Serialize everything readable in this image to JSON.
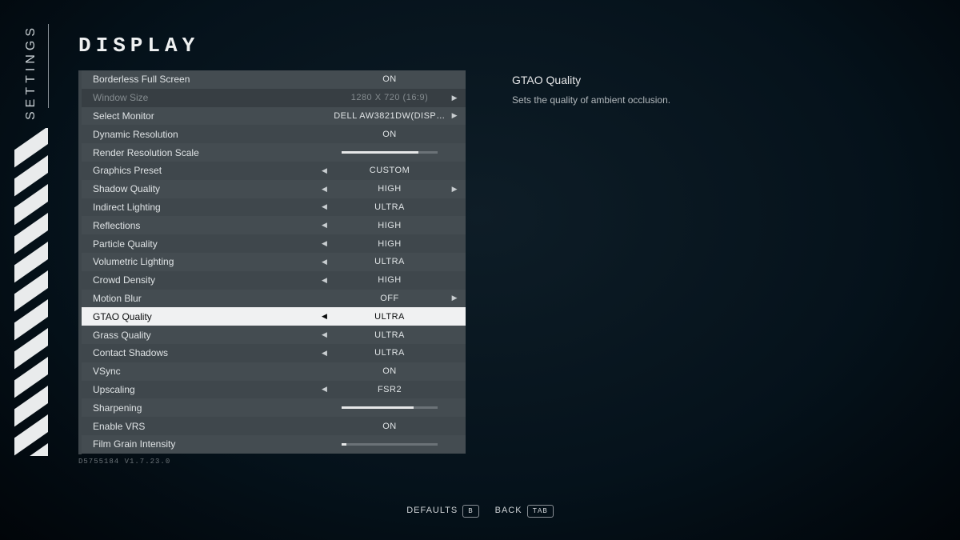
{
  "sidebarLabel": "SETTINGS",
  "pageTitle": "DISPLAY",
  "buildId": "D5755184 V1.7.23.0",
  "description": {
    "title": "GTAO Quality",
    "body": "Sets the quality of ambient occlusion."
  },
  "footer": {
    "defaults": {
      "label": "DEFAULTS",
      "key": "B"
    },
    "back": {
      "label": "BACK",
      "key": "TAB"
    }
  },
  "rows": [
    {
      "label": "Borderless Full Screen",
      "value": "ON",
      "type": "toggle"
    },
    {
      "label": "Window Size",
      "value": "1280 X 720 (16:9)",
      "type": "arrow",
      "showLeft": false,
      "showRight": true,
      "disabled": true
    },
    {
      "label": "Select Monitor",
      "value": "DELL AW3821DW(DISP…",
      "type": "arrow",
      "showLeft": false,
      "showRight": true
    },
    {
      "label": "Dynamic Resolution",
      "value": "ON",
      "type": "toggle"
    },
    {
      "label": "Render Resolution Scale",
      "value": "",
      "type": "slider",
      "pct": 80
    },
    {
      "label": "Graphics Preset",
      "value": "CUSTOM",
      "type": "arrow",
      "showLeft": true,
      "showRight": false
    },
    {
      "label": "Shadow Quality",
      "value": "HIGH",
      "type": "arrow",
      "showLeft": true,
      "showRight": true
    },
    {
      "label": "Indirect Lighting",
      "value": "ULTRA",
      "type": "arrow",
      "showLeft": true,
      "showRight": false
    },
    {
      "label": "Reflections",
      "value": "HIGH",
      "type": "arrow",
      "showLeft": true,
      "showRight": false
    },
    {
      "label": "Particle Quality",
      "value": "HIGH",
      "type": "arrow",
      "showLeft": true,
      "showRight": false
    },
    {
      "label": "Volumetric Lighting",
      "value": "ULTRA",
      "type": "arrow",
      "showLeft": true,
      "showRight": false
    },
    {
      "label": "Crowd Density",
      "value": "HIGH",
      "type": "arrow",
      "showLeft": true,
      "showRight": false
    },
    {
      "label": "Motion Blur",
      "value": "OFF",
      "type": "arrow",
      "showLeft": false,
      "showRight": true
    },
    {
      "label": "GTAO Quality",
      "value": "ULTRA",
      "type": "arrow",
      "showLeft": true,
      "showRight": false,
      "selected": true
    },
    {
      "label": "Grass Quality",
      "value": "ULTRA",
      "type": "arrow",
      "showLeft": true,
      "showRight": false
    },
    {
      "label": "Contact Shadows",
      "value": "ULTRA",
      "type": "arrow",
      "showLeft": true,
      "showRight": false
    },
    {
      "label": "VSync",
      "value": "ON",
      "type": "toggle"
    },
    {
      "label": "Upscaling",
      "value": "FSR2",
      "type": "arrow",
      "showLeft": true,
      "showRight": false
    },
    {
      "label": "Sharpening",
      "value": "",
      "type": "slider",
      "pct": 75
    },
    {
      "label": "Enable VRS",
      "value": "ON",
      "type": "toggle"
    },
    {
      "label": "Film Grain Intensity",
      "value": "",
      "type": "slider",
      "pct": 5
    }
  ]
}
